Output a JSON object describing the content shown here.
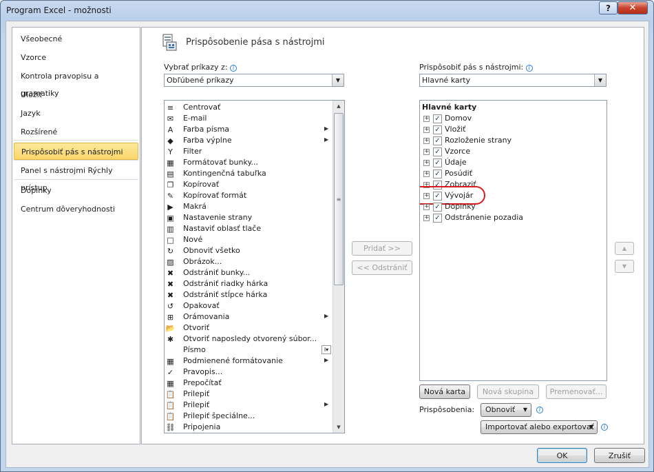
{
  "window": {
    "title": "Program Excel - možnosti",
    "help_label": "?",
    "close_label": "✕"
  },
  "nav": {
    "items": [
      {
        "label": "Všeobecné"
      },
      {
        "label": "Vzorce"
      },
      {
        "label": "Kontrola pravopisu a gramatiky"
      },
      {
        "label": "Uložiť"
      },
      {
        "label": "Jazyk"
      },
      {
        "label": "Rozšírené"
      },
      {
        "label": "Prispôsobiť pás s nástrojmi",
        "selected": true
      },
      {
        "label": "Panel s nástrojmi Rýchly prístup"
      },
      {
        "label": "Doplnky"
      },
      {
        "label": "Centrum dôveryhodnosti"
      }
    ]
  },
  "header": {
    "title": "Prispôsobenie pása s nástrojmi"
  },
  "choose": {
    "label": "Vybrať príkazy z:",
    "value": "Obľúbené príkazy"
  },
  "customize": {
    "label": "Prispôsobiť pás s nástrojmi:",
    "value": "Hlavné karty"
  },
  "commands": [
    {
      "label": "Centrovať",
      "icon": "align-center-icon",
      "glyph": "≡"
    },
    {
      "label": "E-mail",
      "icon": "email-icon",
      "glyph": "✉"
    },
    {
      "label": "Farba písma",
      "icon": "font-color-icon",
      "glyph": "A",
      "submenu": true
    },
    {
      "label": "Farba výplne",
      "icon": "fill-color-icon",
      "glyph": "◆",
      "submenu": true
    },
    {
      "label": "Filter",
      "icon": "filter-icon",
      "glyph": "Y"
    },
    {
      "label": "Formátovať bunky...",
      "icon": "format-cells-icon",
      "glyph": "▦"
    },
    {
      "label": "Kontingenčná tabuľka",
      "icon": "pivot-table-icon",
      "glyph": "▤"
    },
    {
      "label": "Kopírovať",
      "icon": "copy-icon",
      "glyph": "❐"
    },
    {
      "label": "Kopírovať formát",
      "icon": "format-painter-icon",
      "glyph": "✎"
    },
    {
      "label": "Makrá",
      "icon": "macro-icon",
      "glyph": "▶"
    },
    {
      "label": "Nastavenie strany",
      "icon": "page-setup-icon",
      "glyph": "▣"
    },
    {
      "label": "Nastaviť oblasť tlače",
      "icon": "print-area-icon",
      "glyph": "▥"
    },
    {
      "label": "Nové",
      "icon": "new-document-icon",
      "glyph": "□"
    },
    {
      "label": "Obnoviť všetko",
      "icon": "refresh-all-icon",
      "glyph": "↻"
    },
    {
      "label": "Obrázok...",
      "icon": "picture-icon",
      "glyph": "▨"
    },
    {
      "label": "Odstrániť bunky...",
      "icon": "delete-cells-icon",
      "glyph": "✖"
    },
    {
      "label": "Odstrániť riadky hárka",
      "icon": "delete-rows-icon",
      "glyph": "✖"
    },
    {
      "label": "Odstrániť stĺpce hárka",
      "icon": "delete-columns-icon",
      "glyph": "✖"
    },
    {
      "label": "Opakovať",
      "icon": "redo-icon",
      "glyph": "↺"
    },
    {
      "label": "Orámovania",
      "icon": "borders-icon",
      "glyph": "⊞",
      "submenu": true
    },
    {
      "label": "Otvoriť",
      "icon": "open-folder-icon",
      "glyph": "📂"
    },
    {
      "label": "Otvoriť naposledy otvorený súbor...",
      "icon": "recent-file-icon",
      "glyph": "✱"
    },
    {
      "label": "Písmo",
      "icon": "font-icon",
      "glyph": "",
      "combo": true
    },
    {
      "label": "Podmienené formátovanie",
      "icon": "conditional-formatting-icon",
      "glyph": "▦",
      "submenu": true
    },
    {
      "label": "Pravopis...",
      "icon": "spelling-icon",
      "glyph": "✓"
    },
    {
      "label": "Prepočítať",
      "icon": "calculate-icon",
      "glyph": "▦"
    },
    {
      "label": "Prilepiť",
      "icon": "paste-icon",
      "glyph": "📋"
    },
    {
      "label": "Prilepiť",
      "icon": "paste-icon",
      "glyph": "📋",
      "submenu": true
    },
    {
      "label": "Prilepiť špeciálne...",
      "icon": "paste-special-icon",
      "glyph": "📋"
    },
    {
      "label": "Pripojenia",
      "icon": "connections-icon",
      "glyph": "⛓"
    }
  ],
  "tree": {
    "root_label": "Hlavné karty",
    "items": [
      {
        "label": "Domov",
        "checked": true
      },
      {
        "label": "Vložiť",
        "checked": true
      },
      {
        "label": "Rozloženie strany",
        "checked": true
      },
      {
        "label": "Vzorce",
        "checked": true
      },
      {
        "label": "Údaje",
        "checked": true
      },
      {
        "label": "Posúdiť",
        "checked": true
      },
      {
        "label": "Zobraziť",
        "checked": true
      },
      {
        "label": "Vývojár",
        "checked": true,
        "highlighted": true
      },
      {
        "label": "Doplnky",
        "checked": true
      },
      {
        "label": "Odstránenie pozadia",
        "checked": true
      }
    ]
  },
  "buttons": {
    "add": "Pridať >>",
    "remove": "<< Odstrániť",
    "new_tab": "Nová karta",
    "new_group": "Nová skupina",
    "rename": "Premenovať...",
    "customizations_label": "Prispôsobenia:",
    "reset": "Obnoviť",
    "import_export": "Importovať alebo exportovať",
    "ok": "OK",
    "cancel": "Zrušiť"
  },
  "colors": {
    "selection": "#fbd66c",
    "highlight_ring": "#d7191c",
    "accent": "#2b7bd6"
  }
}
